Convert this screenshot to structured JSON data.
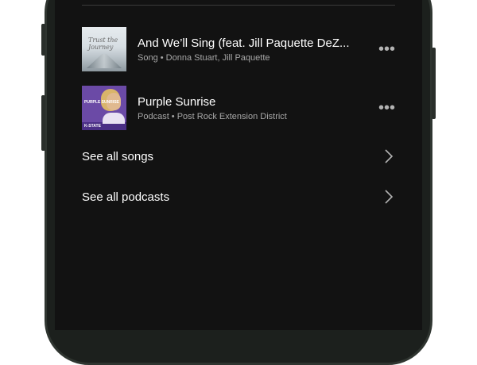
{
  "results": [
    {
      "title": "And We’ll Sing (feat. Jill Paquette DeZ...",
      "subtitle": "Song • Donna Stuart, Jill Paquette",
      "art_text": "Trust the Journey"
    },
    {
      "title": "Purple Sunrise",
      "subtitle": "Podcast • Post Rock Extension District",
      "art_title": "PURPLE SUNRISE",
      "art_brand": "K-STATE"
    }
  ],
  "links": {
    "songs": "See all songs",
    "podcasts": "See all podcasts"
  },
  "icons": {
    "more": "more-icon",
    "chevron": "chevron-right-icon"
  },
  "colors": {
    "background": "#121212",
    "primary_text": "#ffffff",
    "secondary_text": "#a7a7a7"
  }
}
